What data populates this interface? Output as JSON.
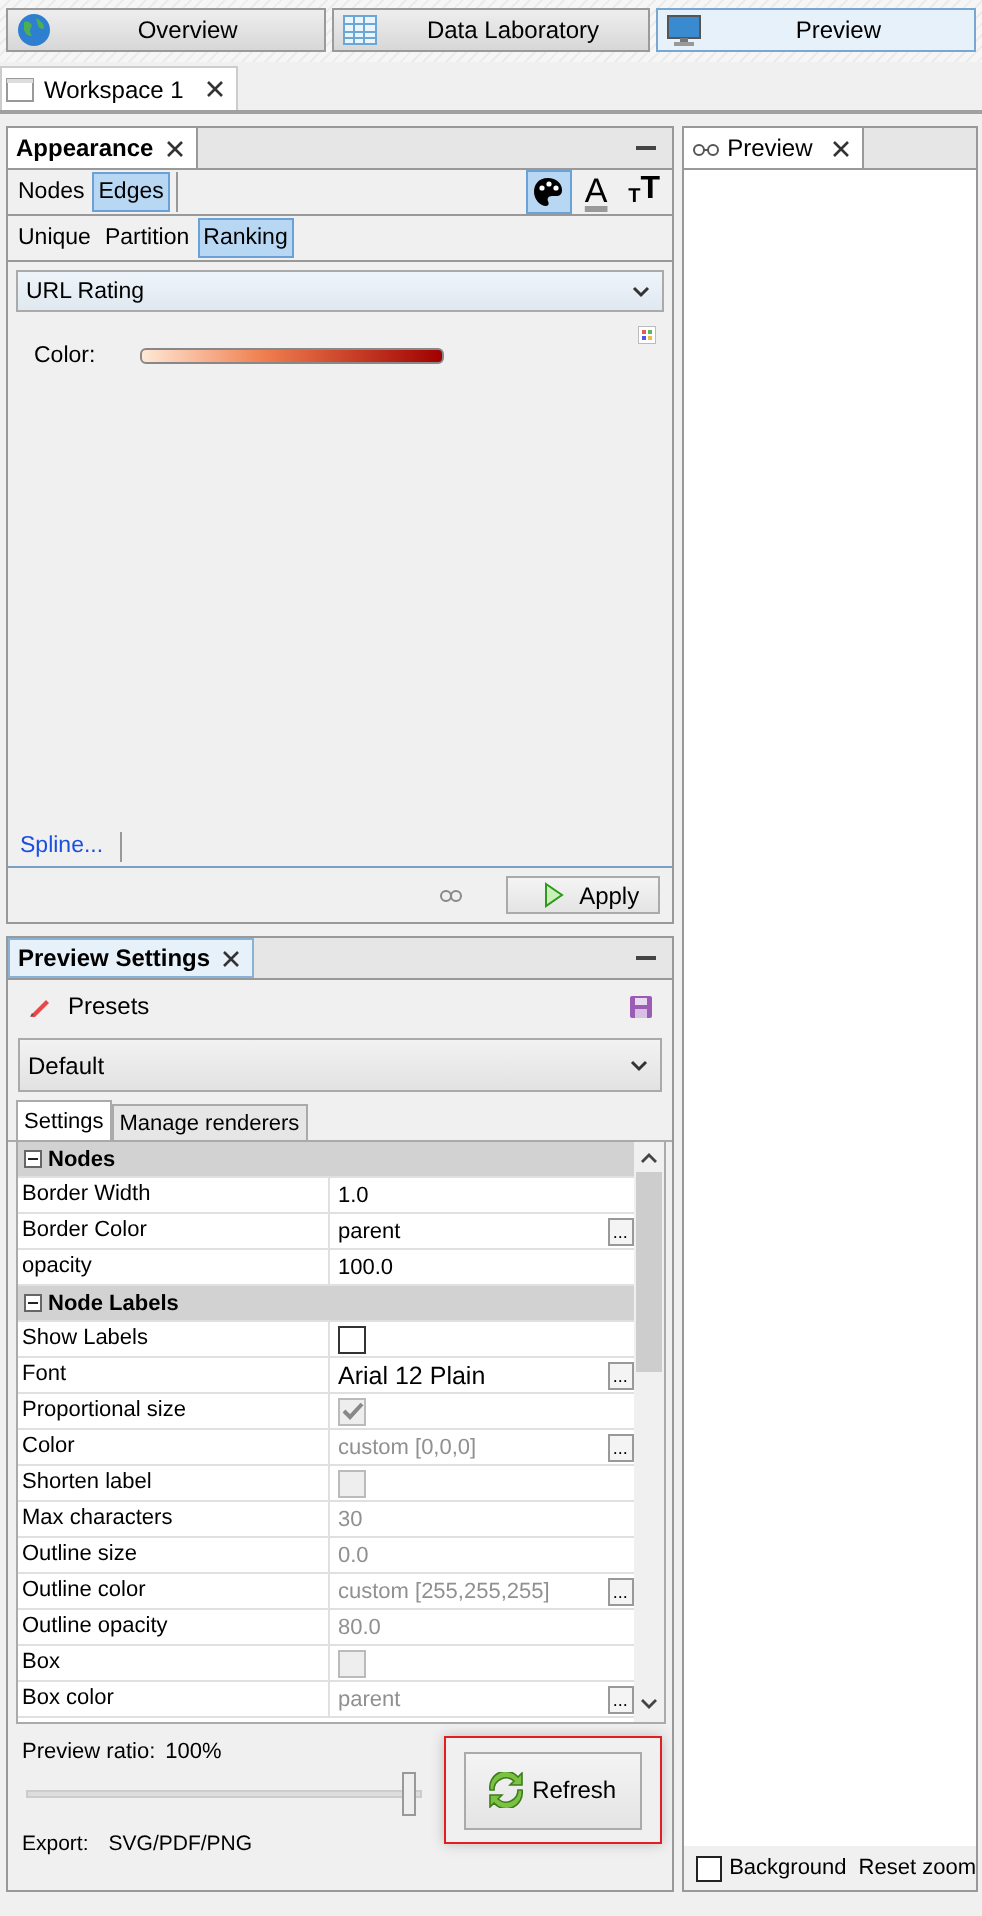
{
  "top_tabs": [
    {
      "label": "Overview",
      "kind": "globe",
      "selected": false
    },
    {
      "label": "Data Laboratory",
      "kind": "table",
      "selected": false
    },
    {
      "label": "Preview",
      "kind": "monitor",
      "selected": true
    }
  ],
  "workspace_tab": {
    "label": "Workspace 1"
  },
  "appearance": {
    "title": "Appearance",
    "element_tabs": [
      {
        "label": "Nodes",
        "selected": false
      },
      {
        "label": "Edges",
        "selected": true
      }
    ],
    "tools": [
      {
        "kind": "color",
        "selected": true
      },
      {
        "kind": "label-color",
        "glyph": "A",
        "selected": false
      },
      {
        "kind": "label-size",
        "glyph_small": "T",
        "glyph_large": "T",
        "selected": false
      }
    ],
    "mode_tabs": [
      {
        "label": "Unique",
        "selected": false
      },
      {
        "label": "Partition",
        "selected": false
      },
      {
        "label": "Ranking",
        "selected": true
      }
    ],
    "attribute": "URL Rating",
    "color_label": "Color:",
    "spline_link": "Spline...",
    "apply_button": "Apply"
  },
  "preview_settings": {
    "title": "Preview Settings",
    "presets_label": "Presets",
    "preset": "Default",
    "tabs": [
      {
        "label": "Settings",
        "selected": true
      },
      {
        "label": "Manage renderers",
        "selected": false
      }
    ],
    "rows": [
      {
        "kind": "header",
        "name": "Nodes",
        "expanded": true
      },
      {
        "kind": "text",
        "name": "Border Width",
        "value": "1.0",
        "disabled": false
      },
      {
        "kind": "picker",
        "name": "Border Color",
        "value": "parent",
        "button": "...",
        "disabled": false
      },
      {
        "kind": "text",
        "name": "opacity",
        "value": "100.0",
        "disabled": false
      },
      {
        "kind": "header",
        "name": "Node Labels",
        "expanded": true
      },
      {
        "kind": "check",
        "name": "Show Labels",
        "checked": false,
        "disabled": false
      },
      {
        "kind": "picker",
        "name": "Font",
        "value": "Arial 12 Plain",
        "button": "...",
        "disabled": false
      },
      {
        "kind": "check",
        "name": "Proportional size",
        "checked": true,
        "disabled": true
      },
      {
        "kind": "picker",
        "name": "Color",
        "value": "custom [0,0,0]",
        "button": "...",
        "disabled": true
      },
      {
        "kind": "check",
        "name": "Shorten label",
        "checked": false,
        "disabled": true
      },
      {
        "kind": "text",
        "name": "Max characters",
        "value": "30",
        "disabled": true
      },
      {
        "kind": "text",
        "name": "Outline size",
        "value": "0.0",
        "disabled": true
      },
      {
        "kind": "picker",
        "name": "Outline color",
        "value": "custom [255,255,255]",
        "button": "...",
        "disabled": true
      },
      {
        "kind": "text",
        "name": "Outline opacity",
        "value": "80.0",
        "disabled": true
      },
      {
        "kind": "check",
        "name": "Box",
        "checked": false,
        "disabled": true
      },
      {
        "kind": "picker",
        "name": "Box color",
        "value": "parent",
        "button": "...",
        "disabled": true
      }
    ],
    "ratio_label": "Preview ratio:",
    "ratio_value": "100%",
    "ratio": {
      "level": 1
    },
    "export_label": "Export:",
    "export_formats": "SVG/PDF/PNG",
    "refresh_button": {
      "label": "Refresh",
      "focused": true
    }
  },
  "preview": {
    "title": "Preview",
    "background_label": "Background",
    "background_checked": false,
    "reset_zoom": "Reset zoom"
  }
}
